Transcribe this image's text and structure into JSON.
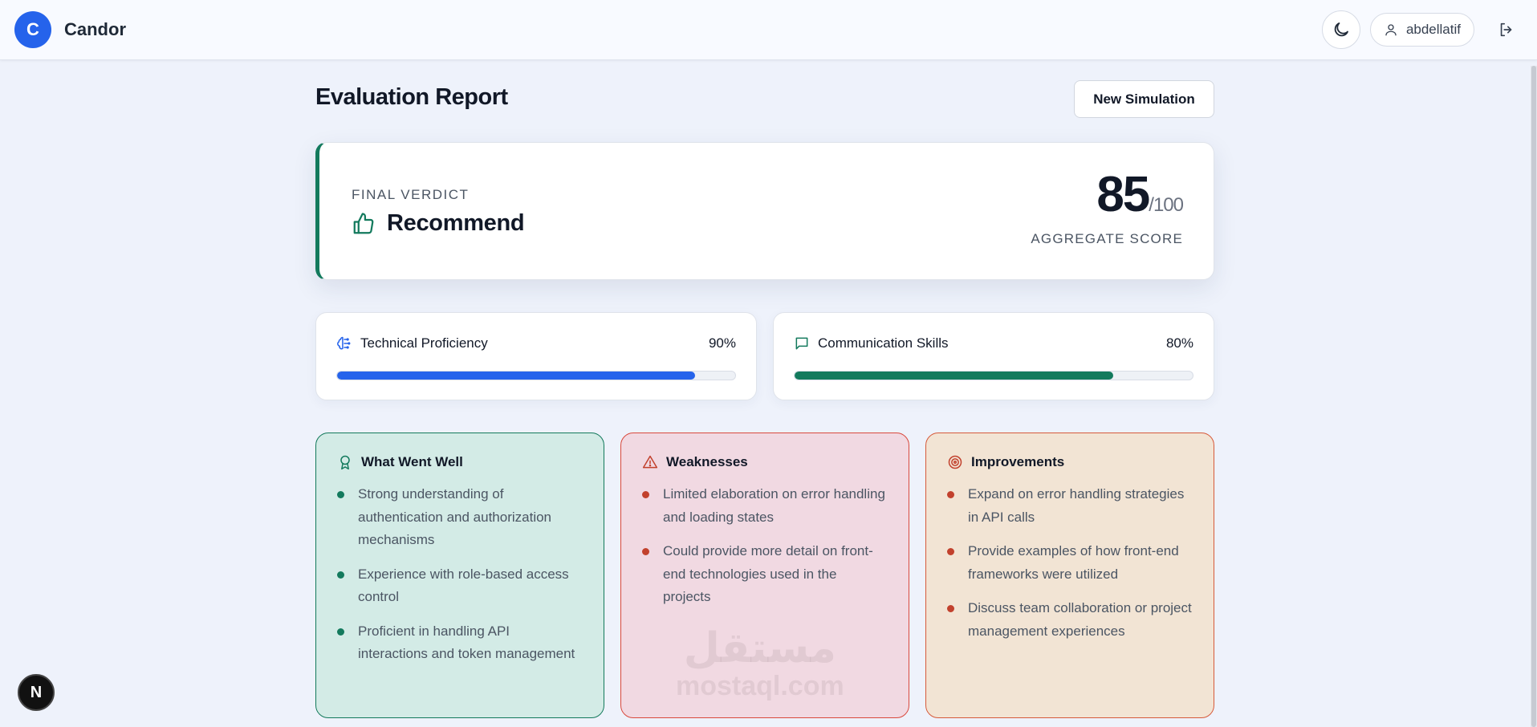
{
  "header": {
    "logo_letter": "C",
    "app_name": "Candor",
    "username": "abdellatif"
  },
  "page": {
    "title": "Evaluation Report",
    "new_simulation_label": "New Simulation"
  },
  "verdict": {
    "label": "FINAL VERDICT",
    "value": "Recommend",
    "score": "85",
    "score_max": "/100",
    "score_label": "AGGREGATE SCORE",
    "accent_color": "#137a5d"
  },
  "metrics": [
    {
      "name": "Technical Proficiency",
      "percent_label": "90%",
      "value": 90,
      "color": "#2563eb",
      "icon": "brain-icon"
    },
    {
      "name": "Communication Skills",
      "percent_label": "80%",
      "value": 80,
      "color": "#137a5d",
      "icon": "chat-icon"
    }
  ],
  "panels": {
    "well": {
      "title": "What Went Well",
      "icon": "award-icon",
      "items": [
        "Strong understanding of authentication and authorization mechanisms",
        "Experience with role-based access control",
        "Proficient in handling API interactions and token management"
      ]
    },
    "weaknesses": {
      "title": "Weaknesses",
      "icon": "warning-icon",
      "items": [
        "Limited elaboration on error handling and loading states",
        "Could provide more detail on front-end technologies used in the projects"
      ]
    },
    "improvements": {
      "title": "Improvements",
      "icon": "target-icon",
      "items": [
        "Expand on error handling strategies in API calls",
        "Provide examples of how front-end frameworks were utilized",
        "Discuss team collaboration or project management experiences"
      ]
    }
  },
  "watermark": {
    "arabic": "مستقل",
    "latin": "mostaql.com"
  },
  "dev_badge": "N"
}
